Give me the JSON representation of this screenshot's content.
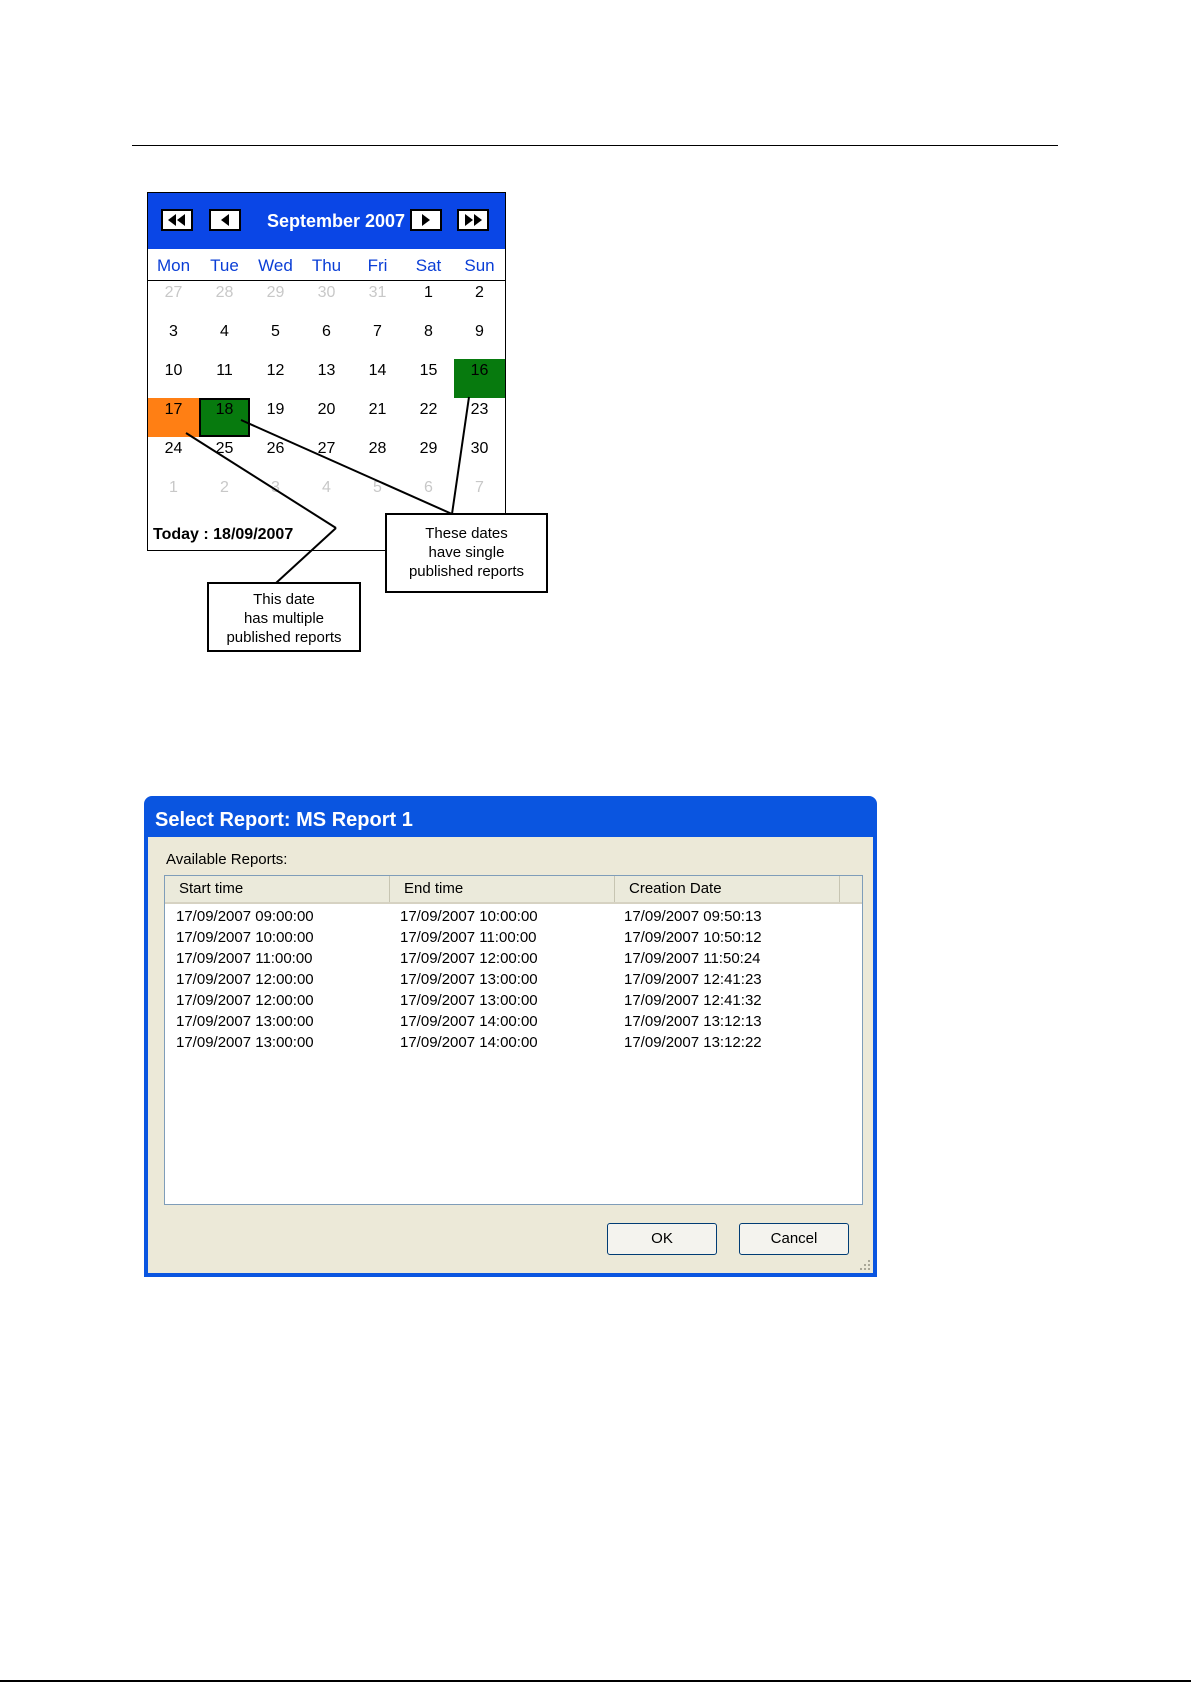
{
  "calendar": {
    "month_label": "September 2007",
    "nav_buttons": [
      "first-page",
      "prev-page",
      "next-page",
      "last-page"
    ],
    "days_of_week": [
      "Mon",
      "Tue",
      "Wed",
      "Thu",
      "Fri",
      "Sat",
      "Sun"
    ],
    "weeks": [
      [
        "27",
        "28",
        "29",
        "30",
        "31",
        "1",
        "2"
      ],
      [
        "3",
        "4",
        "5",
        "6",
        "7",
        "8",
        "9"
      ],
      [
        "10",
        "11",
        "12",
        "13",
        "14",
        "15",
        "16"
      ],
      [
        "17",
        "18",
        "19",
        "20",
        "21",
        "22",
        "23"
      ],
      [
        "24",
        "25",
        "26",
        "27",
        "28",
        "29",
        "30"
      ],
      [
        "1",
        "2",
        "3",
        "4",
        "5",
        "6",
        "7"
      ]
    ],
    "today_text": "Today : 18/09/2007",
    "colors": {
      "header": "#0a46e6",
      "multiple_reports": "#ff7f14",
      "single_report": "#077a0e",
      "other_month": "#c8c8c8"
    }
  },
  "callouts": {
    "single": [
      "These dates",
      "have single",
      "published reports"
    ],
    "multiple": [
      "This date",
      "has multiple",
      "published reports"
    ]
  },
  "dialog": {
    "title": "Select Report: MS Report 1",
    "available_label": "Available Reports:",
    "columns": [
      "Start time",
      "End time",
      "Creation Date"
    ],
    "rows": [
      [
        "17/09/2007 09:00:00",
        "17/09/2007 10:00:00",
        "17/09/2007 09:50:13"
      ],
      [
        "17/09/2007 10:00:00",
        "17/09/2007 11:00:00",
        "17/09/2007 10:50:12"
      ],
      [
        "17/09/2007 11:00:00",
        "17/09/2007 12:00:00",
        "17/09/2007 11:50:24"
      ],
      [
        "17/09/2007 12:00:00",
        "17/09/2007 13:00:00",
        "17/09/2007 12:41:23"
      ],
      [
        "17/09/2007 12:00:00",
        "17/09/2007 13:00:00",
        "17/09/2007 12:41:32"
      ],
      [
        "17/09/2007 13:00:00",
        "17/09/2007 14:00:00",
        "17/09/2007 13:12:13"
      ],
      [
        "17/09/2007 13:00:00",
        "17/09/2007 14:00:00",
        "17/09/2007 13:12:22"
      ]
    ],
    "ok_label": "OK",
    "cancel_label": "Cancel",
    "colors": {
      "titlebar": "#0a55e0",
      "body": "#ece9d8"
    }
  }
}
